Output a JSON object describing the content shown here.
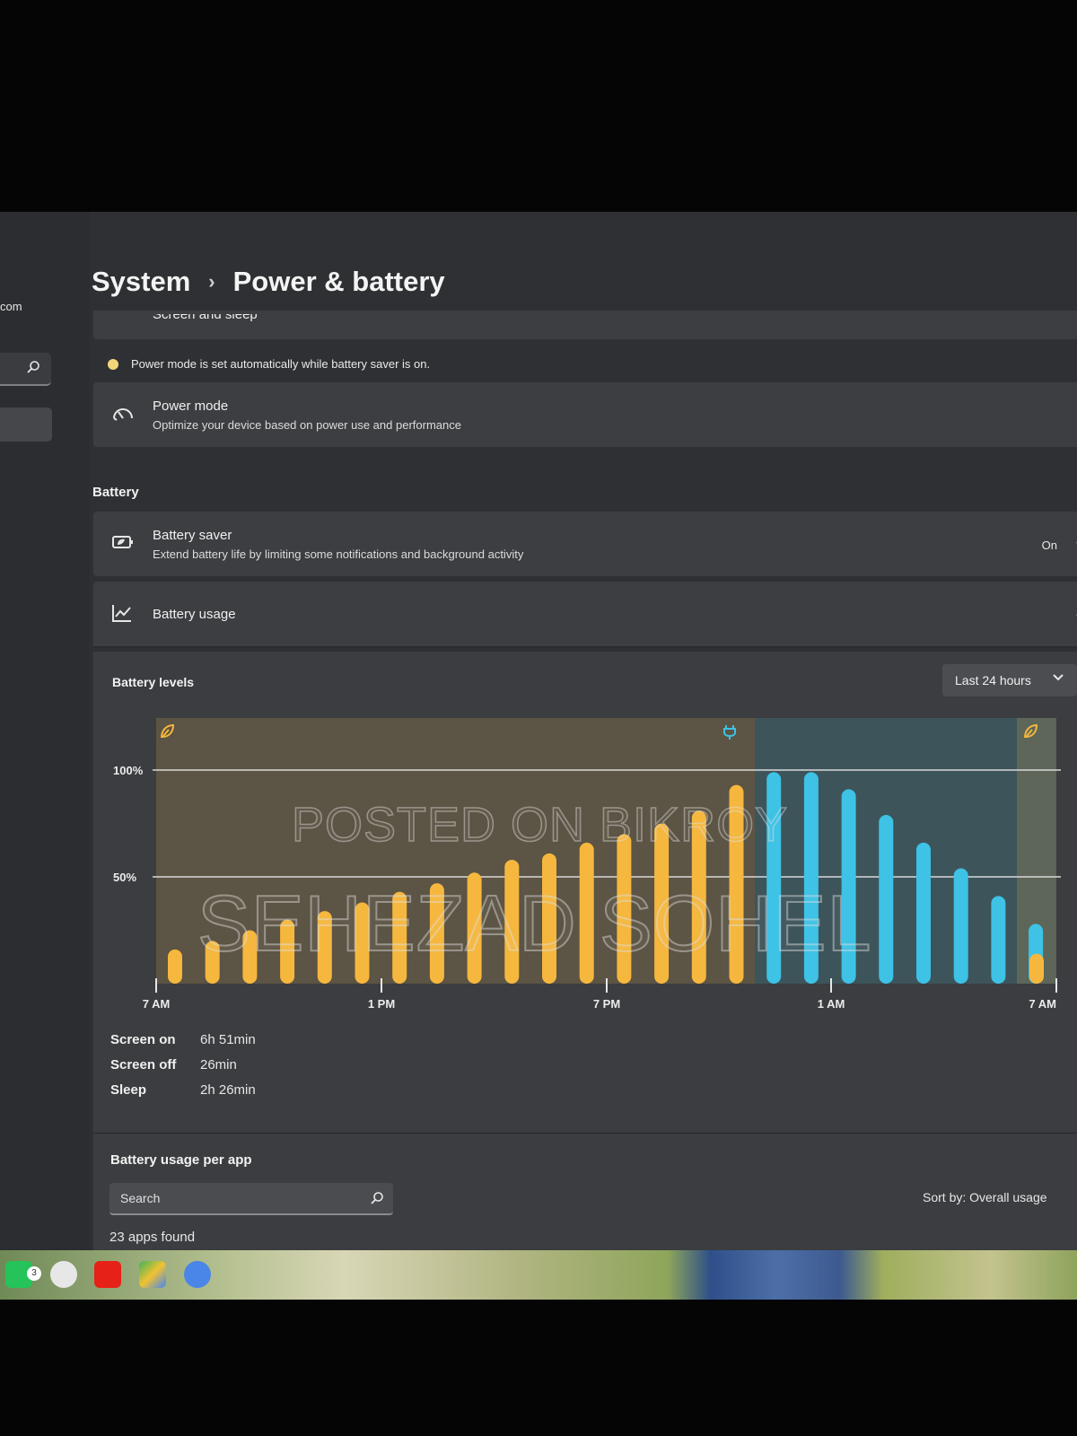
{
  "sidebar": {
    "account_fragment": "com"
  },
  "breadcrumb": {
    "parent": "System",
    "separator": "›",
    "current": "Power & battery"
  },
  "screen_and_sleep": {
    "title": "Screen and sleep"
  },
  "notice": {
    "text": "Power mode is set automatically while battery saver is on."
  },
  "power_mode": {
    "title": "Power mode",
    "description": "Optimize your device based on power use and performance"
  },
  "battery_section": {
    "label": "Battery"
  },
  "battery_saver": {
    "title": "Battery saver",
    "description": "Extend battery life by limiting some notifications and background activity",
    "value": "On"
  },
  "battery_usage": {
    "title": "Battery usage"
  },
  "battery_levels": {
    "label": "Battery levels",
    "range_dropdown": "Last 24 hours"
  },
  "chart_data": {
    "type": "bar",
    "title": "Battery levels",
    "x_tick_labels": [
      "7 AM",
      "1 PM",
      "7 PM",
      "1 AM",
      "7 AM"
    ],
    "y_tick_labels": [
      "100%",
      "50%"
    ],
    "ylim": [
      0,
      100
    ],
    "grid": true,
    "series": [
      {
        "name": "on battery",
        "color": "#f5b73e",
        "values": [
          16,
          20,
          25,
          30,
          34,
          38,
          43,
          47,
          52,
          58,
          61,
          66,
          70,
          75,
          81,
          93
        ]
      },
      {
        "name": "charging",
        "color": "#3ec2e5",
        "values": [
          99,
          99,
          91,
          79,
          66,
          54,
          41,
          28
        ]
      },
      {
        "name": "on battery",
        "color": "#f5b73e",
        "values": [
          14
        ]
      }
    ],
    "marker_icons": [
      "battery-saver-leaf-icon",
      "plugged-in-icon",
      "battery-saver-leaf-icon"
    ]
  },
  "usage_stats": [
    {
      "label": "Screen on",
      "value": "6h 51min"
    },
    {
      "label": "Screen off",
      "value": "26min"
    },
    {
      "label": "Sleep",
      "value": "2h 26min"
    }
  ],
  "per_app": {
    "title": "Battery usage per app",
    "search_placeholder": "Search",
    "sort_label": "Sort by: Overall usage",
    "apps_found": "23 apps found"
  },
  "taskbar": {
    "whatsapp_badge": "3"
  },
  "watermark": {
    "line1": "POSTED ON BIKROY",
    "line2": "SEHEZAD SOHEL"
  }
}
